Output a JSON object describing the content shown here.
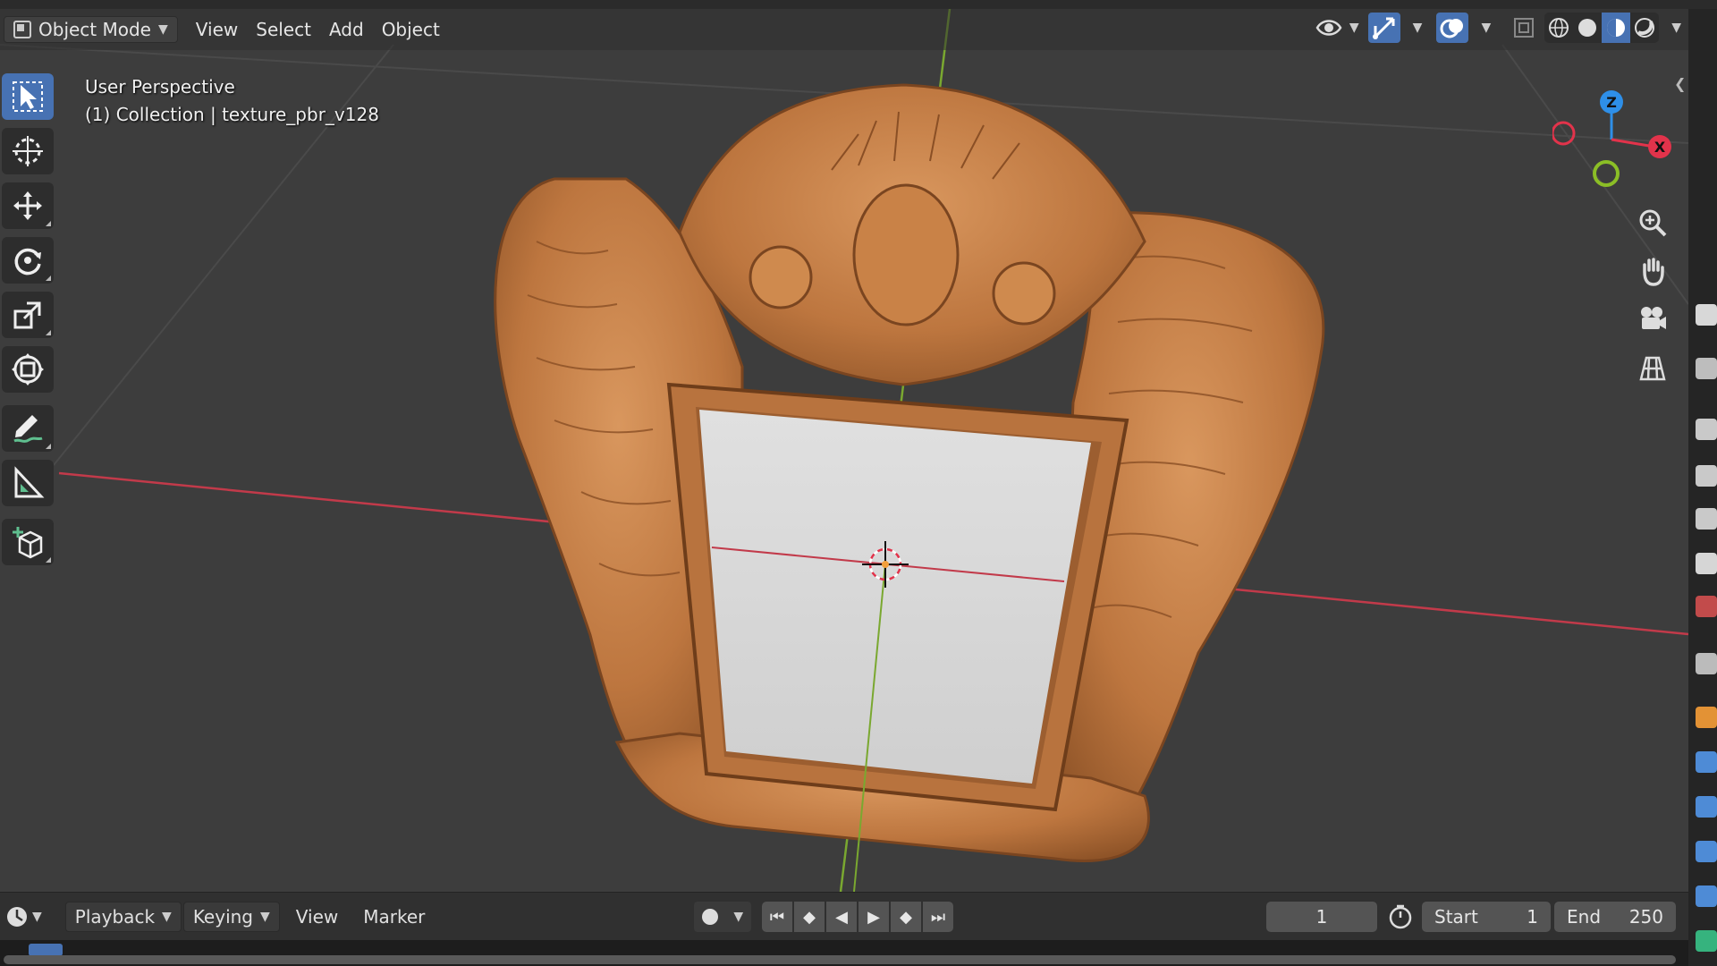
{
  "header": {
    "mode": "Object Mode",
    "menus": [
      "View",
      "Select",
      "Add",
      "Object"
    ]
  },
  "overlay": {
    "perspective": "User Perspective",
    "collection": "(1) Collection | texture_pbr_v128"
  },
  "toolbar_tools": [
    "select-box",
    "cursor",
    "move",
    "rotate",
    "scale",
    "transform",
    "annotate",
    "measure",
    "add-cube"
  ],
  "gizmo": {
    "z": "Z",
    "x": "X",
    "colors": {
      "x": "#e2334b",
      "y": "#8bbe26",
      "z": "#2e8fe8"
    }
  },
  "nav_buttons": [
    "zoom",
    "pan",
    "camera",
    "orthographic-grid"
  ],
  "timeline": {
    "menus": [
      "Playback",
      "Keying",
      "View",
      "Marker"
    ],
    "current_frame": "1",
    "start_label": "Start",
    "start_value": "1",
    "end_label": "End",
    "end_value": "250"
  },
  "colors": {
    "accent": "#4772b3",
    "frame_wood": "#c17a45",
    "x_axis": "#c23a4a",
    "y_axis": "#7aa830"
  }
}
